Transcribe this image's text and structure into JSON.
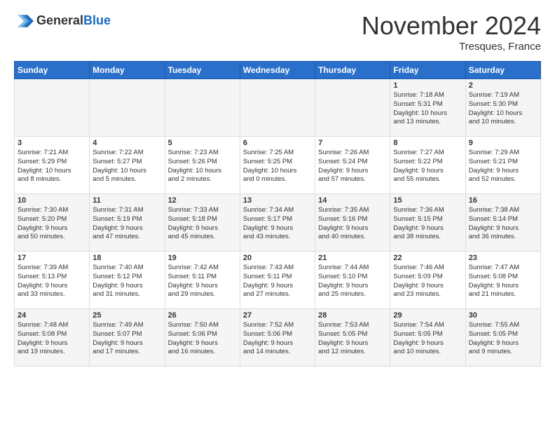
{
  "header": {
    "logo_line1": "General",
    "logo_line2": "Blue",
    "month": "November 2024",
    "location": "Tresques, France"
  },
  "weekdays": [
    "Sunday",
    "Monday",
    "Tuesday",
    "Wednesday",
    "Thursday",
    "Friday",
    "Saturday"
  ],
  "weeks": [
    [
      {
        "day": "",
        "info": ""
      },
      {
        "day": "",
        "info": ""
      },
      {
        "day": "",
        "info": ""
      },
      {
        "day": "",
        "info": ""
      },
      {
        "day": "",
        "info": ""
      },
      {
        "day": "1",
        "info": "Sunrise: 7:18 AM\nSunset: 5:31 PM\nDaylight: 10 hours\nand 13 minutes."
      },
      {
        "day": "2",
        "info": "Sunrise: 7:19 AM\nSunset: 5:30 PM\nDaylight: 10 hours\nand 10 minutes."
      }
    ],
    [
      {
        "day": "3",
        "info": "Sunrise: 7:21 AM\nSunset: 5:29 PM\nDaylight: 10 hours\nand 8 minutes."
      },
      {
        "day": "4",
        "info": "Sunrise: 7:22 AM\nSunset: 5:27 PM\nDaylight: 10 hours\nand 5 minutes."
      },
      {
        "day": "5",
        "info": "Sunrise: 7:23 AM\nSunset: 5:26 PM\nDaylight: 10 hours\nand 2 minutes."
      },
      {
        "day": "6",
        "info": "Sunrise: 7:25 AM\nSunset: 5:25 PM\nDaylight: 10 hours\nand 0 minutes."
      },
      {
        "day": "7",
        "info": "Sunrise: 7:26 AM\nSunset: 5:24 PM\nDaylight: 9 hours\nand 57 minutes."
      },
      {
        "day": "8",
        "info": "Sunrise: 7:27 AM\nSunset: 5:22 PM\nDaylight: 9 hours\nand 55 minutes."
      },
      {
        "day": "9",
        "info": "Sunrise: 7:29 AM\nSunset: 5:21 PM\nDaylight: 9 hours\nand 52 minutes."
      }
    ],
    [
      {
        "day": "10",
        "info": "Sunrise: 7:30 AM\nSunset: 5:20 PM\nDaylight: 9 hours\nand 50 minutes."
      },
      {
        "day": "11",
        "info": "Sunrise: 7:31 AM\nSunset: 5:19 PM\nDaylight: 9 hours\nand 47 minutes."
      },
      {
        "day": "12",
        "info": "Sunrise: 7:33 AM\nSunset: 5:18 PM\nDaylight: 9 hours\nand 45 minutes."
      },
      {
        "day": "13",
        "info": "Sunrise: 7:34 AM\nSunset: 5:17 PM\nDaylight: 9 hours\nand 43 minutes."
      },
      {
        "day": "14",
        "info": "Sunrise: 7:35 AM\nSunset: 5:16 PM\nDaylight: 9 hours\nand 40 minutes."
      },
      {
        "day": "15",
        "info": "Sunrise: 7:36 AM\nSunset: 5:15 PM\nDaylight: 9 hours\nand 38 minutes."
      },
      {
        "day": "16",
        "info": "Sunrise: 7:38 AM\nSunset: 5:14 PM\nDaylight: 9 hours\nand 36 minutes."
      }
    ],
    [
      {
        "day": "17",
        "info": "Sunrise: 7:39 AM\nSunset: 5:13 PM\nDaylight: 9 hours\nand 33 minutes."
      },
      {
        "day": "18",
        "info": "Sunrise: 7:40 AM\nSunset: 5:12 PM\nDaylight: 9 hours\nand 31 minutes."
      },
      {
        "day": "19",
        "info": "Sunrise: 7:42 AM\nSunset: 5:11 PM\nDaylight: 9 hours\nand 29 minutes."
      },
      {
        "day": "20",
        "info": "Sunrise: 7:43 AM\nSunset: 5:11 PM\nDaylight: 9 hours\nand 27 minutes."
      },
      {
        "day": "21",
        "info": "Sunrise: 7:44 AM\nSunset: 5:10 PM\nDaylight: 9 hours\nand 25 minutes."
      },
      {
        "day": "22",
        "info": "Sunrise: 7:46 AM\nSunset: 5:09 PM\nDaylight: 9 hours\nand 23 minutes."
      },
      {
        "day": "23",
        "info": "Sunrise: 7:47 AM\nSunset: 5:08 PM\nDaylight: 9 hours\nand 21 minutes."
      }
    ],
    [
      {
        "day": "24",
        "info": "Sunrise: 7:48 AM\nSunset: 5:08 PM\nDaylight: 9 hours\nand 19 minutes."
      },
      {
        "day": "25",
        "info": "Sunrise: 7:49 AM\nSunset: 5:07 PM\nDaylight: 9 hours\nand 17 minutes."
      },
      {
        "day": "26",
        "info": "Sunrise: 7:50 AM\nSunset: 5:06 PM\nDaylight: 9 hours\nand 16 minutes."
      },
      {
        "day": "27",
        "info": "Sunrise: 7:52 AM\nSunset: 5:06 PM\nDaylight: 9 hours\nand 14 minutes."
      },
      {
        "day": "28",
        "info": "Sunrise: 7:53 AM\nSunset: 5:05 PM\nDaylight: 9 hours\nand 12 minutes."
      },
      {
        "day": "29",
        "info": "Sunrise: 7:54 AM\nSunset: 5:05 PM\nDaylight: 9 hours\nand 10 minutes."
      },
      {
        "day": "30",
        "info": "Sunrise: 7:55 AM\nSunset: 5:05 PM\nDaylight: 9 hours\nand 9 minutes."
      }
    ]
  ]
}
